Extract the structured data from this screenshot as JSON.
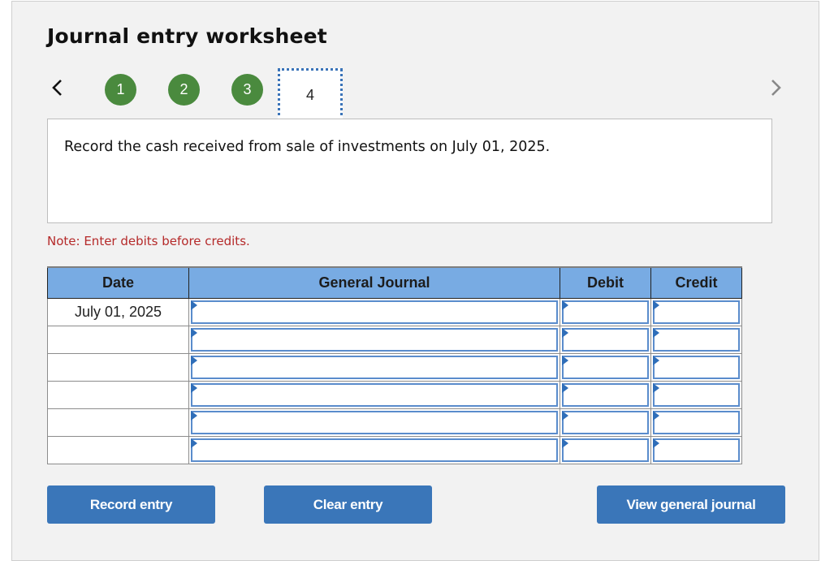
{
  "worksheet": {
    "title": "Journal entry worksheet",
    "steps": [
      {
        "label": "1",
        "state": "completed"
      },
      {
        "label": "2",
        "state": "completed"
      },
      {
        "label": "3",
        "state": "completed"
      },
      {
        "label": "4",
        "state": "current"
      }
    ],
    "prev_icon": "chevron-left-icon",
    "next_icon": "chevron-right-icon",
    "prompt": "Record the cash received from sale of investments on July 01, 2025.",
    "note": "Note: Enter debits before credits.",
    "colors": {
      "step_completed": "#4a8a3e",
      "header": "#78abe3",
      "button": "#3a76b9",
      "note": "#b52a2a"
    }
  },
  "table": {
    "headers": {
      "date": "Date",
      "general_journal": "General Journal",
      "debit": "Debit",
      "credit": "Credit"
    },
    "rows": [
      {
        "date": "July 01, 2025",
        "account": "",
        "debit": "",
        "credit": ""
      },
      {
        "date": "",
        "account": "",
        "debit": "",
        "credit": ""
      },
      {
        "date": "",
        "account": "",
        "debit": "",
        "credit": ""
      },
      {
        "date": "",
        "account": "",
        "debit": "",
        "credit": ""
      },
      {
        "date": "",
        "account": "",
        "debit": "",
        "credit": ""
      },
      {
        "date": "",
        "account": "",
        "debit": "",
        "credit": ""
      }
    ]
  },
  "buttons": {
    "record": "Record entry",
    "clear": "Clear entry",
    "view": "View general journal"
  }
}
